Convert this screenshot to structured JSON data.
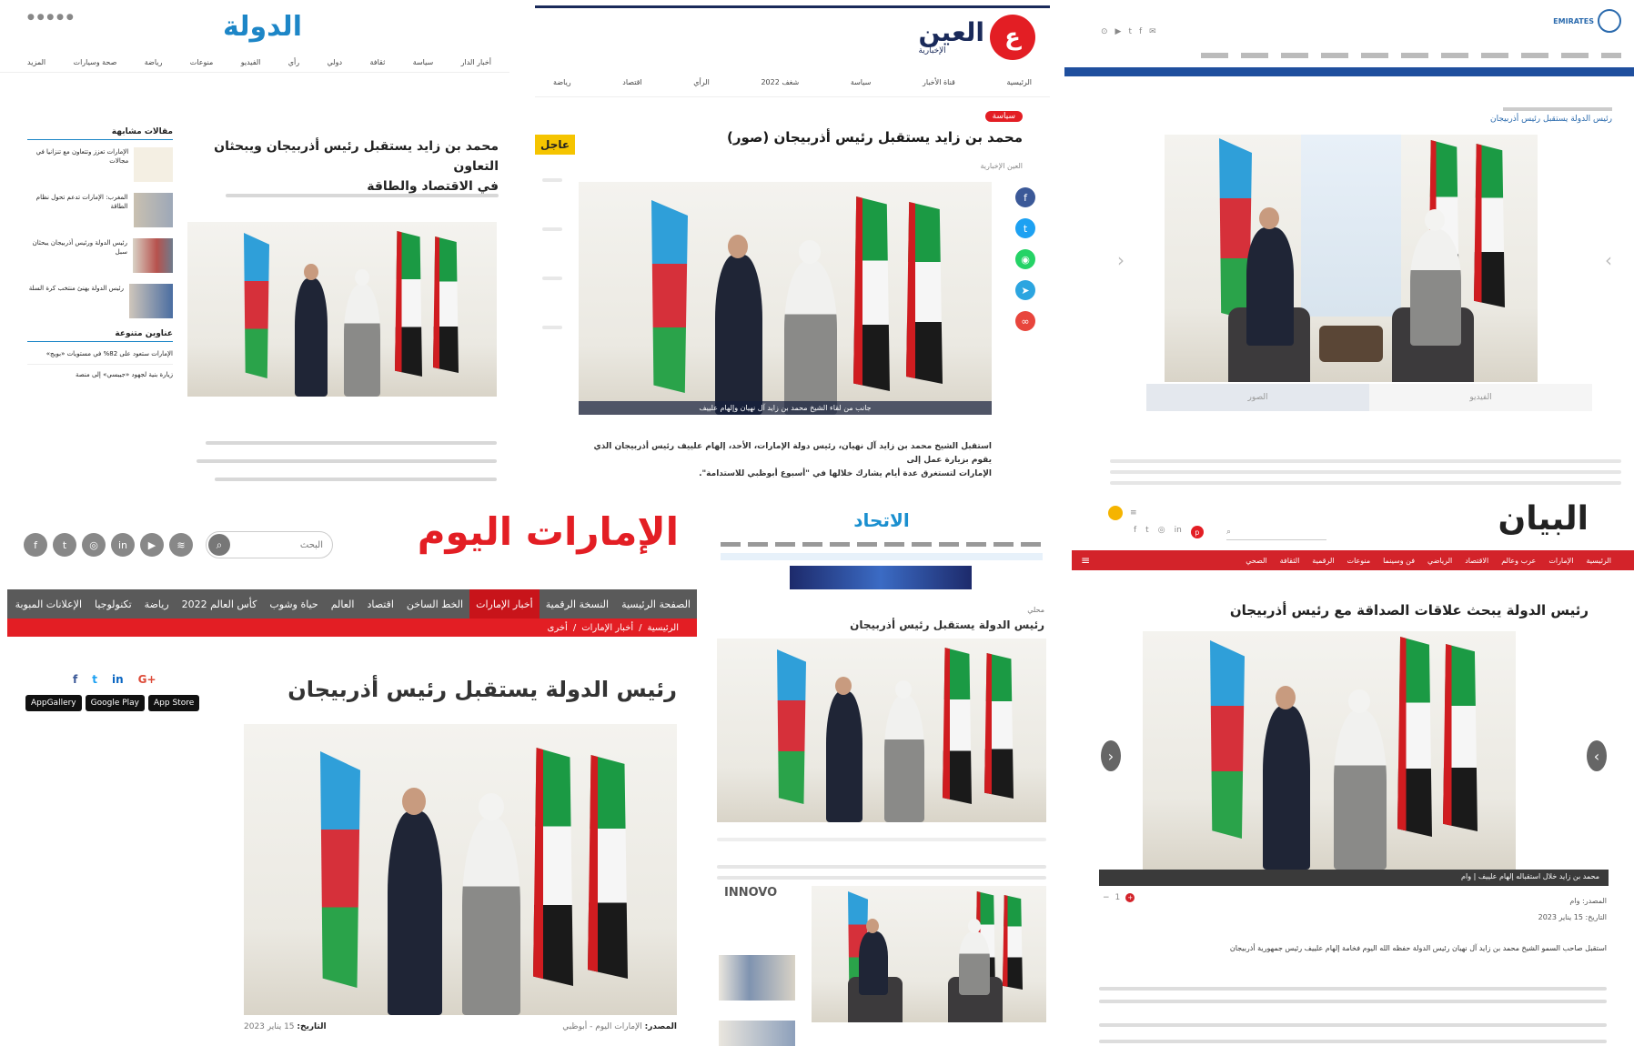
{
  "p1": {
    "logo": "الدولة",
    "nav": [
      "أخبار الدار",
      "سياسة",
      "ثقافة",
      "دولي",
      "رأي",
      "الفيديو",
      "منوعات",
      "رياضة",
      "صحة وسيارات",
      "المزيد"
    ],
    "headline_line1": "محمد بن زايد يستقبل رئيس أذربيجان ويبحثان التعاون",
    "headline_line2": "في الاقتصاد والطاقة",
    "sidebar_heading": "مقالات مشابهة",
    "sidebar_heading2": "عناوين متنوعة",
    "sidebar_items": [
      "الإمارات تعزز وتتعاون مع تنزانيا في مجالات",
      "المغرب: الإمارات تدعم تحول نظام الطاقة",
      "رئيس الدولة ورئيس أذربيجان يبحثان سبل",
      "رئيس الدولة يهنئ منتخب كرة السلة"
    ],
    "list_items": [
      "الإمارات ستعود على 82% في مستويات «بويج»",
      "زيارة بنية لجهود «جيبسي» إلى منصة"
    ]
  },
  "p2": {
    "logo": "العين",
    "logo_sub": "الإخبارية",
    "nav": [
      "الرئيسية",
      "قناة الأخبار",
      "سياسة",
      "شغف 2022",
      "الرأي",
      "اقتصاد",
      "رياضة"
    ],
    "category": "سياسة",
    "headline": "محمد بن زايد يستقبل رئيس أذربيجان (صور)",
    "source": "العين الإخبارية",
    "breaking": "عاجل",
    "caption": "جانب من لقاء الشيخ محمد بن زايد آل نهيان وإلهام علييف",
    "body": "استقبل الشيخ محمد بن زايد آل نهيان، رئيس دولة الإمارات، الأحد، إلهام علييف رئيس أذربيجان الذي يقوم بزيارة عمل إلى",
    "body2": "الإمارات لتستغرق عدة أيام يشارك خلالها في \"أسبوع أبوظبي للاستدامة\".",
    "share_colors": [
      "#3b5998",
      "#1da1f2",
      "#25d366",
      "#2ca5e0",
      "#e8453c"
    ]
  },
  "p3": {
    "logo": "EMIRATES",
    "headline": "رئيس الدولة يستقبل رئيس أذربيجان",
    "tab_photos": "الصور",
    "tab_video": "الفيديو"
  },
  "p4": {
    "logo": "الإمارات اليوم",
    "search_placeholder": "البحث",
    "nav": [
      "الصفحة الرئيسية",
      "النسخة الرقمية",
      "أخبار الإمارات",
      "الخط الساخن",
      "اقتصاد",
      "العالم",
      "حياة وشوب",
      "كأس العالم 2022",
      "رياضة",
      "تكنولوجيا",
      "الإعلانات المبوبة"
    ],
    "active_nav": "أخبار الإمارات",
    "breadcrumb": [
      "الرئيسية",
      "أخبار الإمارات",
      "أخرى"
    ],
    "headline": "رئيس الدولة يستقبل رئيس أذربيجان",
    "store_buttons": [
      "AppGallery",
      "Google Play",
      "App Store"
    ],
    "source_label": "المصدر:",
    "source_value": "الإمارات اليوم - أبوظبي",
    "date_label": "التاريخ:",
    "date_value": "15 يناير 2023"
  },
  "p5": {
    "logo": "الاتحاد",
    "category": "محلي",
    "headline": "رئيس الدولة يستقبل رئيس أذربيجان",
    "sponsor": "INNOVO"
  },
  "p6": {
    "logo": "البيان",
    "nav": [
      "الرئيسية",
      "الإمارات",
      "عرب وعالم",
      "الاقتصاد",
      "الرياضي",
      "فن وسينما",
      "منوعات",
      "الرقمية",
      "الثقافة",
      "الصحي"
    ],
    "headline": "رئيس الدولة يبحث علاقات الصداقة مع رئيس أذربيجان",
    "caption": "محمد بن زايد خلال استقباله إلهام علييف | وام",
    "source_label": "المصدر:",
    "source_value": "وام",
    "date_label": "التاريخ:",
    "date_value": "15 يناير 2023",
    "body": "استقبل صاحب السمو الشيخ محمد بن زايد آل نهيان رئيس الدولة حفظه الله اليوم فخامة إلهام علييف رئيس جمهورية أذربيجان"
  }
}
